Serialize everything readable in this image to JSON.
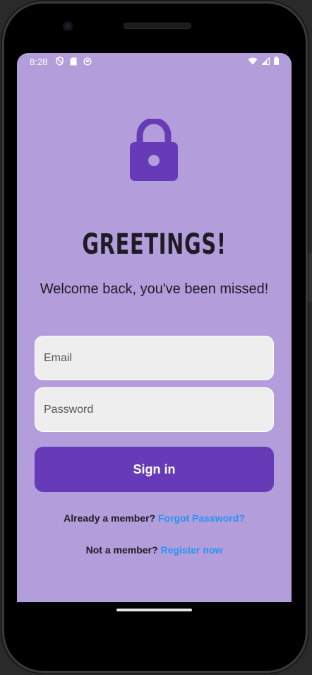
{
  "status_bar": {
    "time": "8:28",
    "left_icons": [
      "shield-icon",
      "sim-card-icon",
      "sync-icon"
    ],
    "right_icons": [
      "wifi-icon",
      "cell-signal-icon",
      "battery-icon"
    ]
  },
  "header": {
    "icon": "lock-icon",
    "title": "GREETINGS!",
    "subtitle": "Welcome back, you've been missed!"
  },
  "form": {
    "email_placeholder": "Email",
    "email_value": "",
    "password_placeholder": "Password",
    "password_value": "",
    "signin_label": "Sign in"
  },
  "footer": {
    "member_prompt": "Already a member?",
    "forgot_link": "Forgot Password?",
    "not_member_prompt": "Not a member?",
    "register_link": "Register now"
  },
  "colors": {
    "background": "#b39ddb",
    "primary": "#673ab7",
    "link": "#2196f3",
    "field": "#eeeeee"
  }
}
